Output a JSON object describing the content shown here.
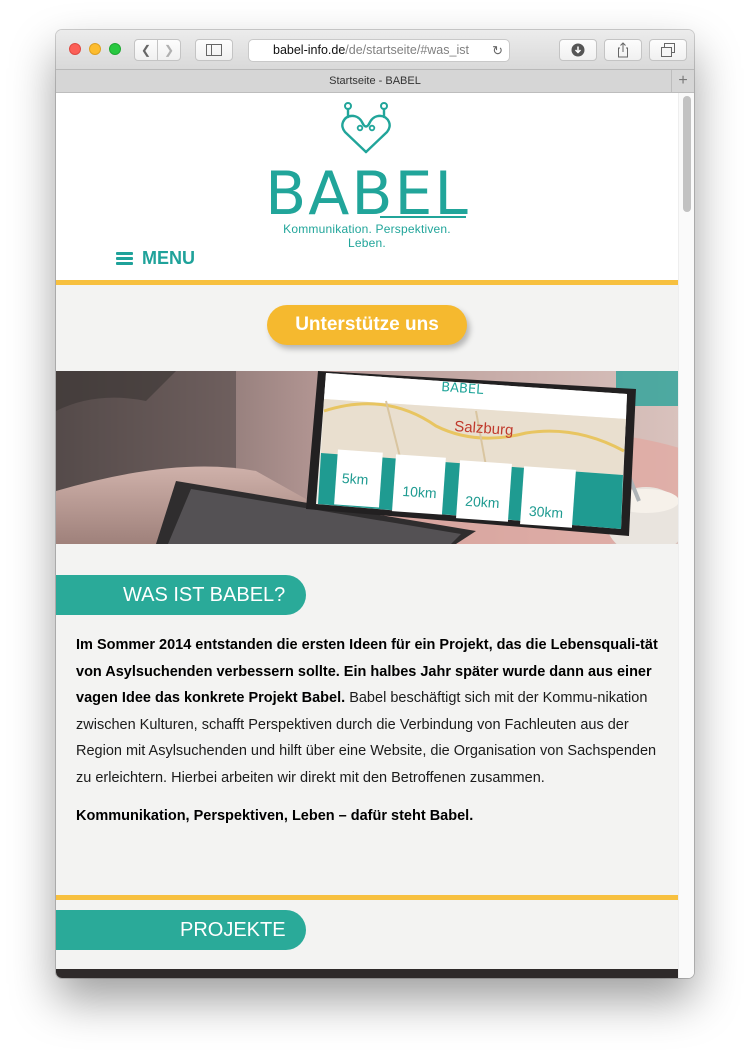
{
  "browser": {
    "url_domain": "babel-info.de",
    "url_path": "/de/startseite/#was_ist",
    "tab_title": "Startseite - BABEL"
  },
  "site": {
    "logo_text": "BABEL",
    "tagline": "Kommunikation. Perspektiven. Leben.",
    "menu_label": "MENU",
    "support_button": "Unterstütze uns",
    "brand_color": "#21a59a",
    "accent_color": "#f7c03f"
  },
  "hero": {
    "map_label": "Salzburg",
    "screen_logo": "BABEL",
    "cards": [
      "5km",
      "10km",
      "20km",
      "30km"
    ]
  },
  "about": {
    "heading": "WAS IST BABEL?",
    "bold_intro": "Im Sommer 2014 entstanden die ersten Ideen für ein Projekt, das die Lebensquali-tät von Asylsuchenden verbessern sollte. Ein halbes Jahr später wurde dann aus einer vagen Idee das konkrete Projekt Babel.",
    "body": " Babel beschäftigt sich mit der Kommu-nikation zwischen Kulturen, schafft Perspektiven durch die Verbindung von Fachleuten aus der Region mit Asylsuchenden und hilft über eine Website, die Organisation von Sachspenden zu erleichtern. Hierbei arbeiten wir direkt mit den Betroffenen zusammen.",
    "closing": "Kommunikation, Perspektiven, Leben – dafür steht Babel."
  },
  "projects": {
    "heading": "PROJEKTE"
  }
}
